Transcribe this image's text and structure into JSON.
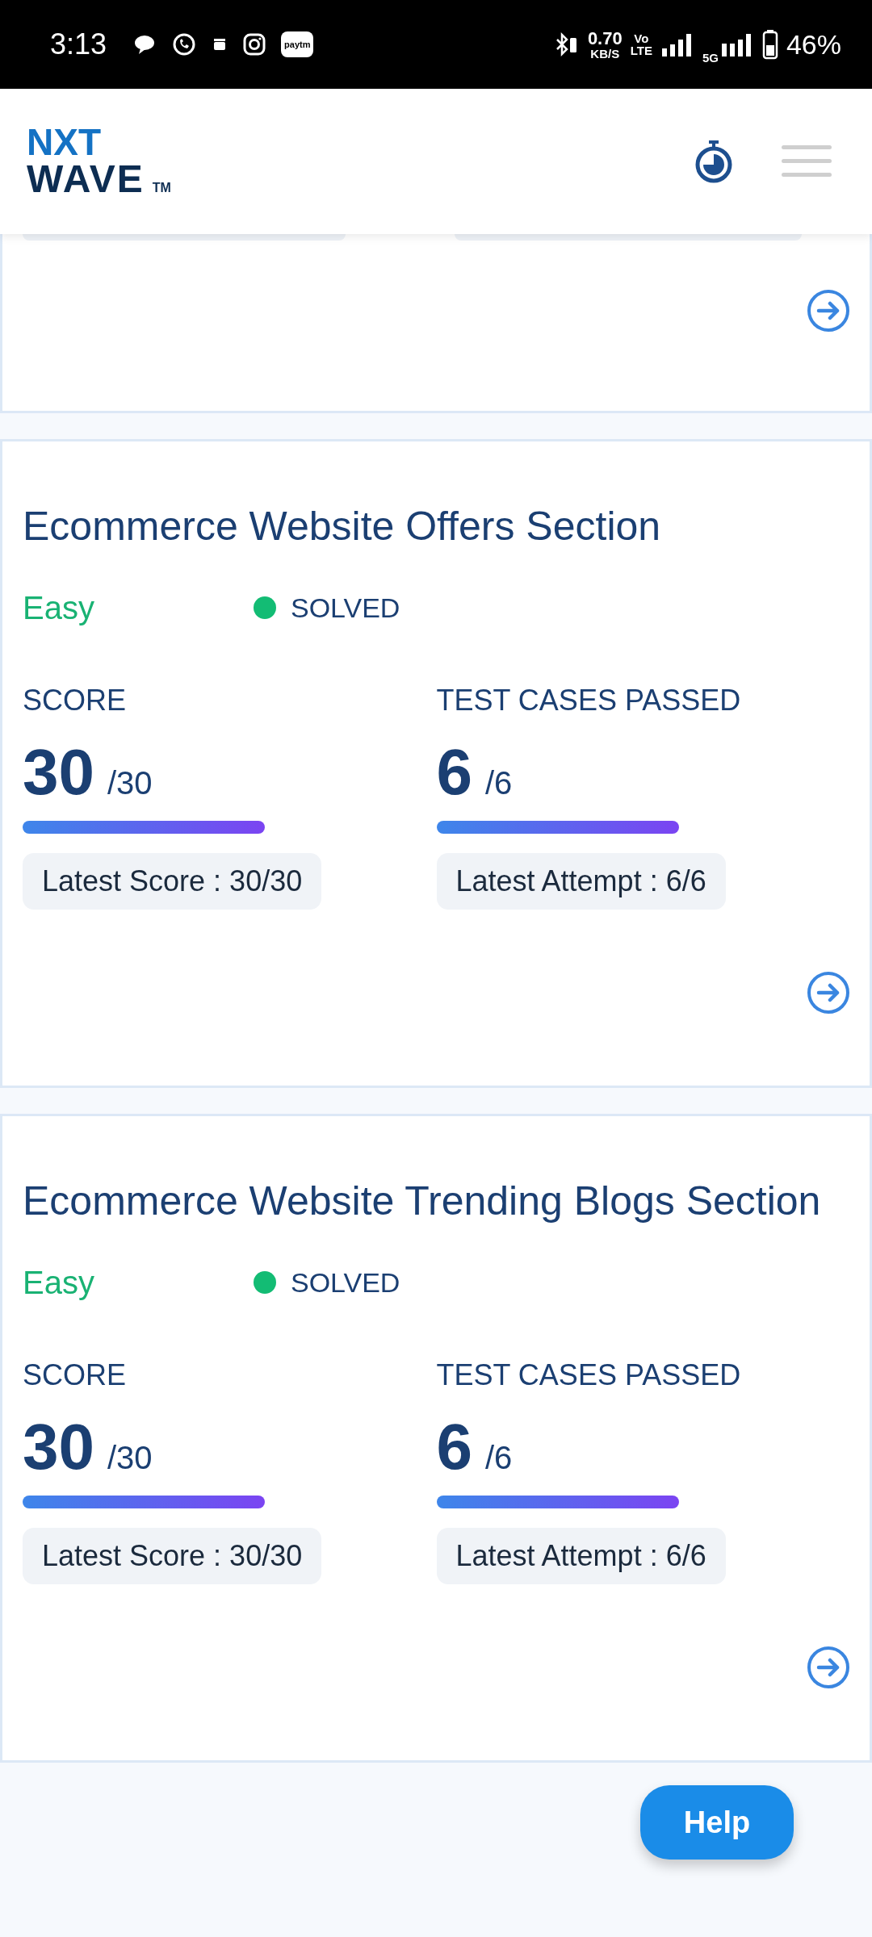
{
  "status_bar": {
    "time": "3:13",
    "paytm": "paytm",
    "speed": "0.70",
    "speed_unit": "KB/S",
    "volte_top": "Vo",
    "volte_bottom": "LTE",
    "network": "5G",
    "battery": "46%"
  },
  "header": {
    "logo_top": "NXT",
    "logo_bottom": "WAVE",
    "logo_mark": "TM"
  },
  "cards": [
    {
      "kind": "partial"
    },
    {
      "kind": "full",
      "title": "Ecommerce Website Offers Section",
      "difficulty": "Easy",
      "solved": true,
      "status": "SOLVED",
      "metrics": [
        {
          "label": "SCORE",
          "value": "30",
          "total": "/30",
          "note": "Latest Score : 30/30"
        },
        {
          "label": "TEST CASES PASSED",
          "value": "6",
          "total": "/6",
          "note": "Latest Attempt : 6/6"
        }
      ]
    },
    {
      "kind": "full",
      "title": "Ecommerce Website Trending Blogs Section",
      "difficulty": "Easy",
      "solved": true,
      "status": "SOLVED",
      "metrics": [
        {
          "label": "SCORE",
          "value": "30",
          "total": "/30",
          "note": "Latest Score : 30/30"
        },
        {
          "label": "TEST CASES PASSED",
          "value": "6",
          "total": "/6",
          "note": "Latest Attempt : 6/6"
        }
      ]
    }
  ],
  "help_button": "Help"
}
